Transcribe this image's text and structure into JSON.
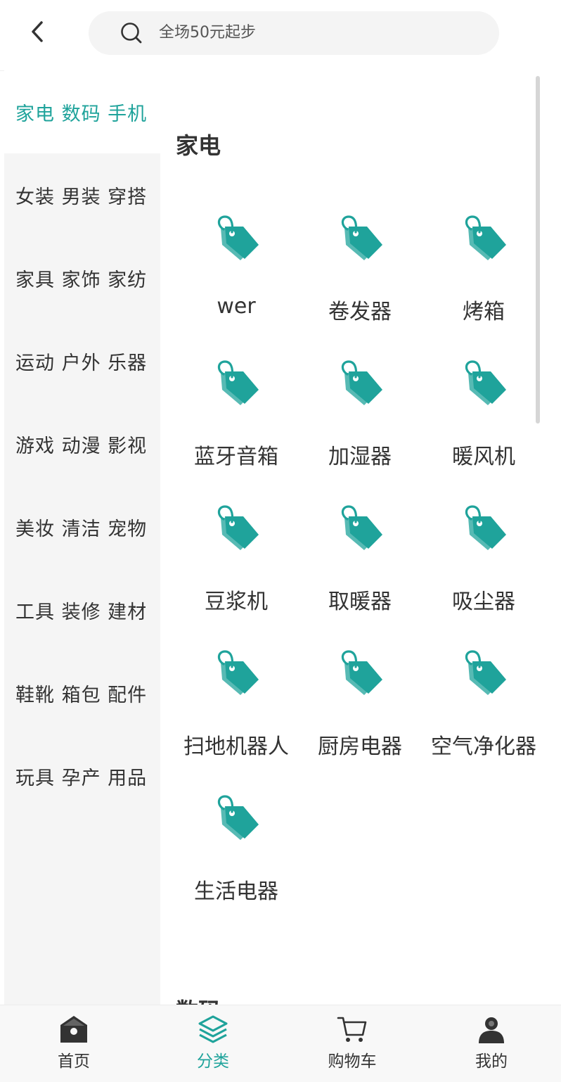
{
  "header": {
    "back_icon": "chevron-left-icon",
    "search": {
      "placeholder": "全场50元起步",
      "icon": "search-icon"
    }
  },
  "sidebar": {
    "items": [
      {
        "label": "家电 数码 手机",
        "active": true
      },
      {
        "label": "女装 男装 穿搭",
        "active": false
      },
      {
        "label": "家具 家饰 家纺",
        "active": false
      },
      {
        "label": "运动 户外 乐器",
        "active": false
      },
      {
        "label": "游戏 动漫 影视",
        "active": false
      },
      {
        "label": "美妆 清洁 宠物",
        "active": false
      },
      {
        "label": "工具 装修 建材",
        "active": false
      },
      {
        "label": "鞋靴 箱包 配件",
        "active": false
      },
      {
        "label": "玩具 孕产 用品",
        "active": false
      }
    ]
  },
  "content": {
    "section_title": "家电",
    "next_section_title": "数码",
    "item_icon": "price-tag-icon",
    "items": [
      "wer",
      "卷发器",
      "烤箱",
      "蓝牙音箱",
      "加湿器",
      "暖风机",
      "豆浆机",
      "取暖器",
      "吸尘器",
      "扫地机器人",
      "厨房电器",
      "空气净化器",
      "生活电器"
    ]
  },
  "bottom_nav": {
    "items": [
      {
        "label": "首页",
        "icon": "home-icon",
        "active": false
      },
      {
        "label": "分类",
        "icon": "layers-icon",
        "active": true
      },
      {
        "label": "购物车",
        "icon": "cart-icon",
        "active": false
      },
      {
        "label": "我的",
        "icon": "user-icon",
        "active": false
      }
    ]
  },
  "colors": {
    "accent": "#1fa39b",
    "sidebar_bg": "#f5f5f5",
    "text": "#333333",
    "nav_bg": "#f8f8f8"
  }
}
